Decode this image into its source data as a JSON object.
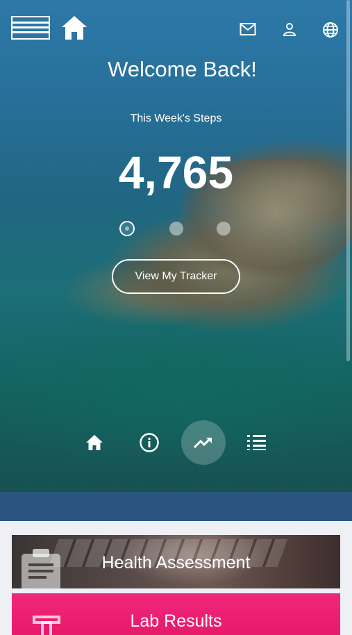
{
  "hero": {
    "welcome": "Welcome Back!",
    "steps_label": "This Week's Steps",
    "steps_value": "4,765",
    "tracker_button": "View My Tracker",
    "carousel_active_index": 0,
    "carousel_count": 3
  },
  "header": {
    "icons": [
      "menu-icon",
      "home-icon",
      "mail-icon",
      "user-icon",
      "globe-icon"
    ]
  },
  "bottom_nav": {
    "items": [
      "home-icon",
      "info-icon",
      "trending-up-icon",
      "list-icon"
    ],
    "active": "trending-up-icon"
  },
  "cards": [
    {
      "label": "Health Assessment",
      "icon": "clipboard-icon"
    },
    {
      "label": "Lab Results",
      "icon": "lab-icon",
      "color": "#ec2174"
    }
  ],
  "colors": {
    "strip": "#2b5580",
    "lab_card": "#ec2174",
    "background": "#eef0f5"
  }
}
